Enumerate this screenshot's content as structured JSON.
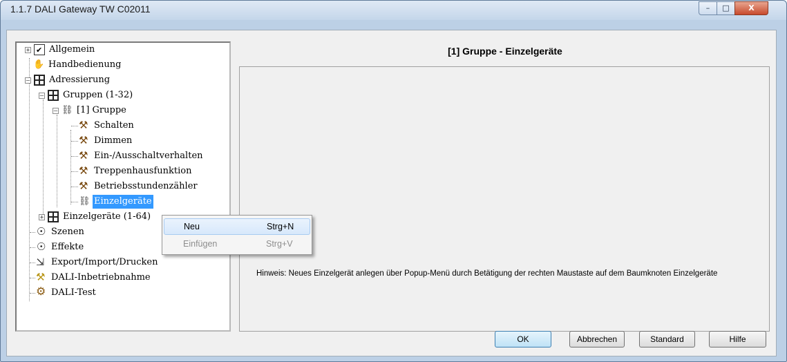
{
  "window": {
    "title": "1.1.7 DALI Gateway TW C02011",
    "controls": {
      "minimize": "–",
      "maximize": "□",
      "close": "X"
    }
  },
  "tree": {
    "items": [
      {
        "label": "Allgemein",
        "icon": "checklist-icon",
        "expander": "+"
      },
      {
        "label": "Handbedienung",
        "icon": "hand-icon"
      },
      {
        "label": "Adressierung",
        "icon": "grid-icon",
        "expander": "–"
      },
      {
        "label": "Gruppen (1-32)",
        "icon": "grid-icon",
        "expander": "–"
      },
      {
        "label": "[1] Gruppe",
        "icon": "link-icon",
        "expander": "–"
      },
      {
        "label": "Schalten",
        "icon": "tool-icon"
      },
      {
        "label": "Dimmen",
        "icon": "tool-icon"
      },
      {
        "label": "Ein-/Ausschaltverhalten",
        "icon": "tool-icon"
      },
      {
        "label": "Treppenhausfunktion",
        "icon": "tool-icon"
      },
      {
        "label": "Betriebsstundenzähler",
        "icon": "tool-icon"
      },
      {
        "label": "Einzelgeräte",
        "icon": "link-icon",
        "selected": true
      },
      {
        "label": "Einzelgeräte (1-64)",
        "icon": "grid-icon",
        "expander": "+"
      },
      {
        "label": "Szenen",
        "icon": "bulb-icon"
      },
      {
        "label": "Effekte",
        "icon": "bulb-icon"
      },
      {
        "label": "Export/Import/Drucken",
        "icon": "export-icon"
      },
      {
        "label": "DALI-Inbetriebnahme",
        "icon": "wrench-icon"
      },
      {
        "label": "DALI-Test",
        "icon": "gear-icon"
      }
    ]
  },
  "panel": {
    "title": "[1] Gruppe - Einzelgeräte",
    "hint": "Hinweis: Neues Einzelgerät anlegen über Popup-Menü durch Betätigung der rechten  Maustaste auf dem Baumknoten Einzelgeräte"
  },
  "context_menu": {
    "items": [
      {
        "label": "Neu",
        "shortcut": "Strg+N",
        "enabled": true
      },
      {
        "label": "Einfügen",
        "shortcut": "Strg+V",
        "enabled": false
      }
    ]
  },
  "buttons": {
    "ok": "OK",
    "cancel": "Abbrechen",
    "standard": "Standard",
    "help": "Hilfe"
  },
  "colors": {
    "selection": "#3399ff",
    "titlebar": "#c4d6ea",
    "close": "#c74b2d"
  }
}
